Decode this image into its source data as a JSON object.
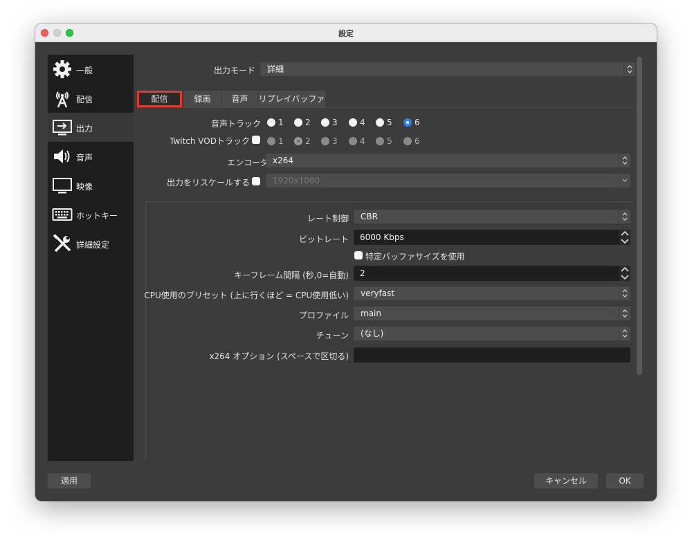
{
  "window": {
    "title": "設定"
  },
  "sidebar": {
    "items": [
      {
        "label": "一般",
        "icon": "gear-icon"
      },
      {
        "label": "配信",
        "icon": "broadcast-antenna-icon"
      },
      {
        "label": "出力",
        "icon": "output-monitor-icon",
        "active": true
      },
      {
        "label": "音声",
        "icon": "speaker-icon"
      },
      {
        "label": "映像",
        "icon": "monitor-icon"
      },
      {
        "label": "ホットキー",
        "icon": "keyboard-icon"
      },
      {
        "label": "詳細設定",
        "icon": "tools-icon"
      }
    ]
  },
  "output_mode": {
    "label": "出力モード",
    "value": "詳細"
  },
  "tabs": [
    {
      "label": "配信",
      "active": true
    },
    {
      "label": "録画"
    },
    {
      "label": "音声"
    },
    {
      "label": "リプレイバッファ"
    }
  ],
  "audio_track": {
    "label": "音声トラック",
    "options": [
      "1",
      "2",
      "3",
      "4",
      "5",
      "6"
    ],
    "selected": "6"
  },
  "twitch_vod": {
    "label": "Twitch VODトラック",
    "checked": false,
    "options": [
      "1",
      "2",
      "3",
      "4",
      "5",
      "6"
    ],
    "selected": "2"
  },
  "encoder": {
    "label": "エンコーダ",
    "value": "x264"
  },
  "rescale": {
    "label": "出力をリスケールする",
    "checked": false,
    "value": "1920x1080"
  },
  "rate_control": {
    "label": "レート制御",
    "value": "CBR"
  },
  "bitrate": {
    "label": "ビットレート",
    "value": "6000 Kbps"
  },
  "custom_buffer": {
    "label": "特定バッファサイズを使用",
    "checked": false
  },
  "keyframe": {
    "label": "キーフレーム間隔 (秒,0=自動)",
    "value": "2"
  },
  "cpu_preset": {
    "label": "CPU使用のプリセット (上に行くほど = CPU使用低い)",
    "value": "veryfast"
  },
  "profile": {
    "label": "プロファイル",
    "value": "main"
  },
  "tune": {
    "label": "チューン",
    "value": "(なし)"
  },
  "x264_options": {
    "label": "x264 オプション (スペースで区切る)",
    "value": ""
  },
  "buttons": {
    "apply": "適用",
    "cancel": "キャンセル",
    "ok": "OK"
  },
  "colors": {
    "accent": "#2f7ef7",
    "highlight": "#e23b2e",
    "bg": "#3c3c3c",
    "sidebar": "#1e1e1e"
  }
}
